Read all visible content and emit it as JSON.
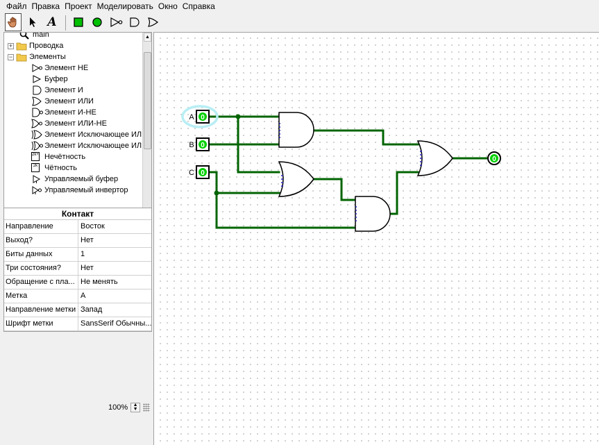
{
  "menu": [
    "Файл",
    "Правка",
    "Проект",
    "Моделировать",
    "Окно",
    "Справка"
  ],
  "toolbar": {
    "tools": [
      {
        "name": "poke-tool",
        "icon": "hand-icon"
      },
      {
        "name": "select-tool",
        "icon": "arrow-icon"
      },
      {
        "name": "text-tool",
        "icon": "text-a-icon"
      },
      {
        "name": "input-pin",
        "icon": "input-pin-icon"
      },
      {
        "name": "output-pin",
        "icon": "output-pin-icon"
      },
      {
        "name": "not-gate",
        "icon": "not-gate-icon"
      },
      {
        "name": "and-gate",
        "icon": "and-gate-icon"
      },
      {
        "name": "or-gate",
        "icon": "or-gate-icon"
      }
    ],
    "text_tool_label": "A"
  },
  "tree": {
    "items": [
      {
        "label": "main",
        "level": 1,
        "icon": "magnifier-icon"
      },
      {
        "label": "Проводка",
        "level": 0,
        "icon": "folder-icon",
        "expander": "+"
      },
      {
        "label": "Элементы",
        "level": 0,
        "icon": "folder-icon",
        "expander": "−"
      },
      {
        "label": "Элемент НЕ",
        "level": 2,
        "icon": "not-gate-icon"
      },
      {
        "label": "Буфер",
        "level": 2,
        "icon": "buffer-icon"
      },
      {
        "label": "Элемент И",
        "level": 2,
        "icon": "and-gate-icon"
      },
      {
        "label": "Элемент ИЛИ",
        "level": 2,
        "icon": "or-gate-icon"
      },
      {
        "label": "Элемент И-НЕ",
        "level": 2,
        "icon": "nand-gate-icon"
      },
      {
        "label": "Элемент ИЛИ-НЕ",
        "level": 2,
        "icon": "nor-gate-icon"
      },
      {
        "label": "Элемент Исключающее ИЛ",
        "level": 2,
        "icon": "xor-gate-icon"
      },
      {
        "label": "Элемент Исключающее ИЛ",
        "level": 2,
        "icon": "xnor-gate-icon"
      },
      {
        "label": "Нечётность",
        "level": 2,
        "icon": "odd-parity-icon"
      },
      {
        "label": "Чётность",
        "level": 2,
        "icon": "even-parity-icon"
      },
      {
        "label": "Управляемый буфер",
        "level": 2,
        "icon": "controlled-buffer-icon"
      },
      {
        "label": "Управляемый инвертор",
        "level": 2,
        "icon": "controlled-inverter-icon"
      }
    ],
    "parity_odd_glyph": "2k+1",
    "parity_even_glyph": "2k"
  },
  "props": {
    "title": "Контакт",
    "rows": [
      {
        "key": "Направление",
        "value": "Восток"
      },
      {
        "key": "Выход?",
        "value": "Нет"
      },
      {
        "key": "Биты данных",
        "value": "1"
      },
      {
        "key": "Три состояния?",
        "value": "Нет"
      },
      {
        "key": "Обращение с пла...",
        "value": "Не менять"
      },
      {
        "key": "Метка",
        "value": "A"
      },
      {
        "key": "Направление метки",
        "value": "Запад"
      },
      {
        "key": "Шрифт метки",
        "value": "SansSerif Обычны..."
      }
    ]
  },
  "zoom": "100%",
  "circuit": {
    "inputs": [
      {
        "label": "A",
        "value": "0"
      },
      {
        "label": "B",
        "value": "0"
      },
      {
        "label": "C",
        "value": "0"
      }
    ],
    "output_value": "0",
    "colors": {
      "wire": "#006400",
      "pin_green": "#00d000",
      "select_ring": "#b8eef4",
      "stub": "#2020c0"
    }
  }
}
